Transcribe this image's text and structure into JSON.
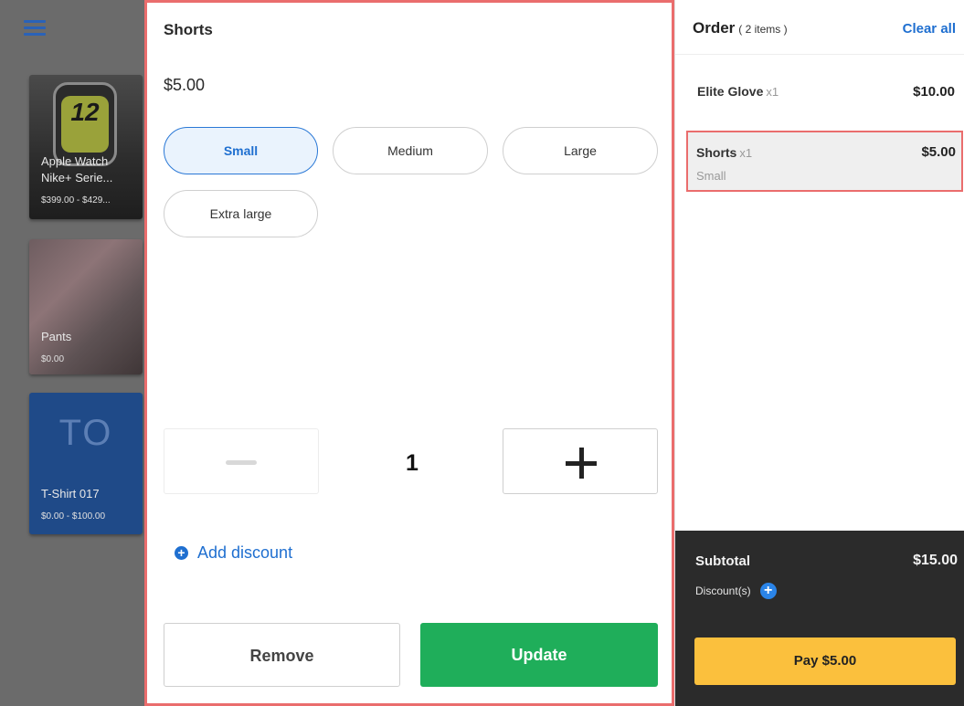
{
  "menu": {
    "icon": "hamburger-menu-icon"
  },
  "products": [
    {
      "name_line1": "Apple Watch",
      "name_line2": "Nike+ Serie...",
      "price": "$399.00 - $429...",
      "watch_numbers": "12"
    },
    {
      "name": "Pants",
      "price": "$0.00"
    },
    {
      "initials": "TO",
      "name": "T-Shirt 017",
      "price": "$0.00 - $100.00"
    }
  ],
  "editor": {
    "title": "Shorts",
    "price": "$5.00",
    "options": [
      {
        "label": "Small",
        "selected": true
      },
      {
        "label": "Medium",
        "selected": false
      },
      {
        "label": "Large",
        "selected": false
      },
      {
        "label": "Extra large",
        "selected": false
      }
    ],
    "quantity": "1",
    "add_discount": "Add discount",
    "remove": "Remove",
    "update": "Update"
  },
  "order": {
    "title": "Order",
    "count": "( 2 items )",
    "clear_all": "Clear all",
    "lines": [
      {
        "name": "Elite Glove",
        "qty": "x1",
        "price": "$10.00"
      },
      {
        "name": "Shorts",
        "qty": "x1",
        "price": "$5.00",
        "variant": "Small"
      }
    ],
    "subtotal_label": "Subtotal",
    "subtotal_value": "$15.00",
    "discounts_label": "Discount(s)",
    "pay": "Pay $5.00"
  },
  "colors": {
    "accent_blue": "#1f6fd0",
    "update_green": "#1fae5a",
    "pay_yellow": "#fbc03d",
    "highlight_red": "#ea6d6d",
    "footer_dark": "#2b2b2b"
  }
}
